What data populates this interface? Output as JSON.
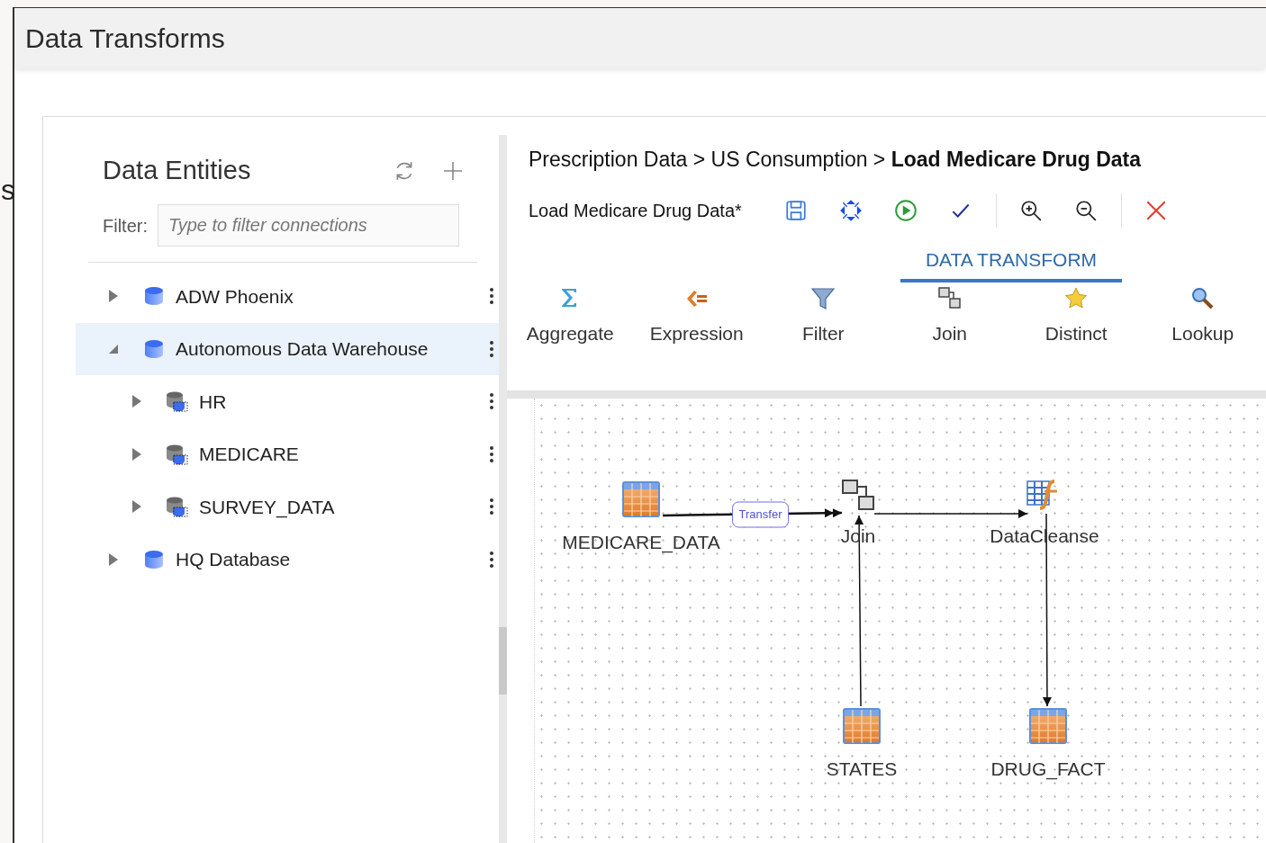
{
  "background_text": "s",
  "window": {
    "title": "Data Transforms"
  },
  "entities_panel": {
    "title": "Data Entities",
    "filter_label": "Filter:",
    "filter_placeholder": "Type to filter connections",
    "tree": [
      {
        "label": "ADW Phoenix",
        "kind": "connection",
        "expanded": false,
        "selected": false
      },
      {
        "label": "Autonomous Data Warehouse",
        "kind": "connection",
        "expanded": true,
        "selected": true,
        "children": [
          {
            "label": "HR",
            "kind": "schema",
            "expanded": false,
            "selected": false
          },
          {
            "label": "MEDICARE",
            "kind": "schema",
            "expanded": false,
            "selected": false
          },
          {
            "label": "SURVEY_DATA",
            "kind": "schema",
            "expanded": false,
            "selected": false
          }
        ]
      },
      {
        "label": "HQ Database",
        "kind": "connection",
        "expanded": false,
        "selected": false
      }
    ]
  },
  "editor": {
    "breadcrumb": "Prescription Data > US Consumption > **Load Medicare Drug Data**",
    "flow_name": "Load Medicare Drug Data*",
    "toolbar_groups": [
      [
        {
          "kind": "save"
        },
        {
          "kind": "fit"
        },
        {
          "kind": "run"
        },
        {
          "kind": "validate"
        }
      ],
      [
        {
          "kind": "zoom_in"
        },
        {
          "kind": "zoom_out"
        }
      ],
      [
        {
          "kind": "close"
        }
      ]
    ],
    "tabs": [
      {
        "label": "DATA TRANSFORM",
        "selected": true
      }
    ],
    "palette": [
      {
        "label": "Aggregate",
        "kind": "aggregate"
      },
      {
        "label": "Expression",
        "kind": "expression"
      },
      {
        "label": "Filter",
        "kind": "filter"
      },
      {
        "label": "Join",
        "kind": "join"
      },
      {
        "label": "Distinct",
        "kind": "distinct"
      },
      {
        "label": "Lookup",
        "kind": "lookup"
      }
    ],
    "diagram": {
      "nodes": [
        {
          "label": "MEDICARE_DATA",
          "kind": "table"
        },
        {
          "label": "Join",
          "kind": "join"
        },
        {
          "label": "DataCleanse",
          "kind": "expression"
        },
        {
          "label": "STATES",
          "kind": "table"
        },
        {
          "label": "DRUG_FACT",
          "kind": "table"
        }
      ],
      "edges": [
        {
          "kind": "double_arrow",
          "label": "Transfer"
        },
        {
          "kind": "arrow"
        },
        {
          "kind": "arrow"
        },
        {
          "kind": "arrow"
        }
      ]
    }
  }
}
